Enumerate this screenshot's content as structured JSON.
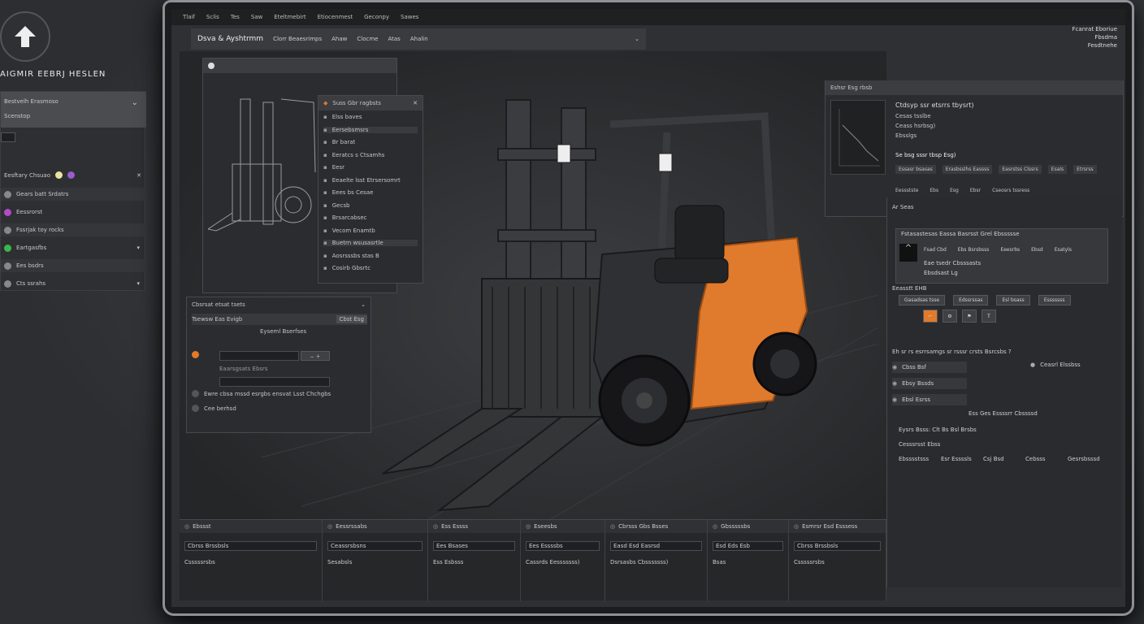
{
  "app": {
    "brand": "AIGMIR EEBRJ HESLEN",
    "menu": [
      "Tlaif",
      "Sclis",
      "Tes",
      "Saw",
      "Eteltmebirt",
      "Etiocenmest",
      "Geconpy",
      "Sawes"
    ]
  },
  "toolbar": {
    "title": "Dsva & Ayshtrmm",
    "items": [
      "Clorr Beaesrimps",
      "Ahaw",
      "Clocme",
      "Atas",
      "Ahalin"
    ]
  },
  "right_header": {
    "lines": [
      "Fcanrat Eboriue",
      "Fbsdma",
      "Fesdtnehe"
    ]
  },
  "left_external": {
    "header": "Bestvelh Erasmoso",
    "header_sub": "Scenstop",
    "section": "Eesftary Chsuao",
    "items": [
      "Gears batt Srdatrs",
      "Eessrorst",
      "Fssrjak toy rocks",
      "Eartgasfbs",
      "Ees bsdrs",
      "Cts ssrahs"
    ],
    "item_colors": [
      "#888888",
      "#b44ac8",
      "#888888",
      "#3cb64a",
      "#888888",
      "#888888"
    ]
  },
  "float_panel_a": {
    "title": "Suss Gbr ragbsts",
    "rows": [
      "Elss baves",
      "Eersebsmsrs",
      "Br barat",
      "Eeratcs s Ctsamhs",
      "Eesr",
      "Eeaelte lsst Etrsersomrt",
      "Eees bs Cesae",
      "Gecsb",
      "Brsarcabsec",
      "Vecom Enamtb",
      "Buetrn wsusasrtle",
      "Aosrsssbs stas B",
      "Cosirb Gbsrtc"
    ]
  },
  "props_panel": {
    "title": "Cbsrsat etsat tsets",
    "subtitle": "Tsewsw Eas Evigb",
    "tag": "Cbst Esg",
    "label": "Eyseml Bserfses",
    "select": "Eaarsgsats Ebsrs",
    "desc": "Ewre cbsa mssd esrgbs ensvat Lsst Chchgbs",
    "foot": "Cee berhsd"
  },
  "upper_right": {
    "title": "Eshsr Esg rbsb",
    "heading": "Ctdsyp ssr etsrrs tbysrt)",
    "lines": [
      "Cesas tsslbe",
      "Ceass hsrbsg)",
      "Ebsslgs"
    ],
    "sub": "Se bsg sssr tbsp Esg)",
    "tabs": [
      "Essasr bsasas",
      "Erasbsslhs Eassss",
      "Easrstss Clssrs",
      "Esals",
      "Etrsrss"
    ],
    "icons_row": [
      "Eessstste",
      "Ebs",
      "Esg",
      "Ebsr",
      "Cseosrs tssress"
    ]
  },
  "right_panel": {
    "section": "Ar Seas",
    "list_header": "Fstasastesas Eassa Basrsst Grel Ebssssse",
    "list_cols": [
      "Fsad Cbd",
      "Ebs Bsrsbsss",
      "Eeesrbs",
      "Ebsd",
      "Esatyls"
    ],
    "list_rows": [
      "Eae tsedr Cbsssasts",
      "Ebsdsast Lg"
    ],
    "subhead": "Eeasstt EHB",
    "buttons": [
      "Gasadsas tsse",
      "Edssrssas",
      "Esl bsass",
      "Esssssss"
    ],
    "question": "Eh sr rs esrrsamgs sr rsssr crsts Bsrcsbs ?",
    "opts": [
      "Cbss Bsf",
      "Ebsy Bssds",
      "Ebsl Esrss"
    ],
    "opts2": [
      "Ceasrl Elssbss"
    ],
    "divider": "Ess Ges Essssrr Cbssssd",
    "nav": [
      "Eysrs Bsss: Clt Bs Bsl Brsbs",
      "Cesssrsst Ebss",
      "Ebsssstsss",
      "Esr Essssls",
      "Csj Bsd",
      "Cebsss",
      "Gesrsbsssd"
    ]
  },
  "bottom": {
    "cols": [
      "Ebssst",
      "Eessrssabs",
      "Ess Essss",
      "Eseesbs",
      "Cbrsss Gbs Bsses",
      "Gbsssssbs",
      "Esmrsr Esd Esssess"
    ],
    "items": [
      "Cbrss Brssbsls",
      "Csssssrsbs",
      "Ceassrsbsns",
      "Sesabsls",
      "Ees Bsases",
      "Ess Esbsss",
      "Ees Essssbs",
      "Cassrds Eesssssss)",
      "Easd Esd Easrsd",
      "Dsrsasbs Cbsssssss)",
      "Esd Eds Esb",
      "Bsas"
    ]
  }
}
